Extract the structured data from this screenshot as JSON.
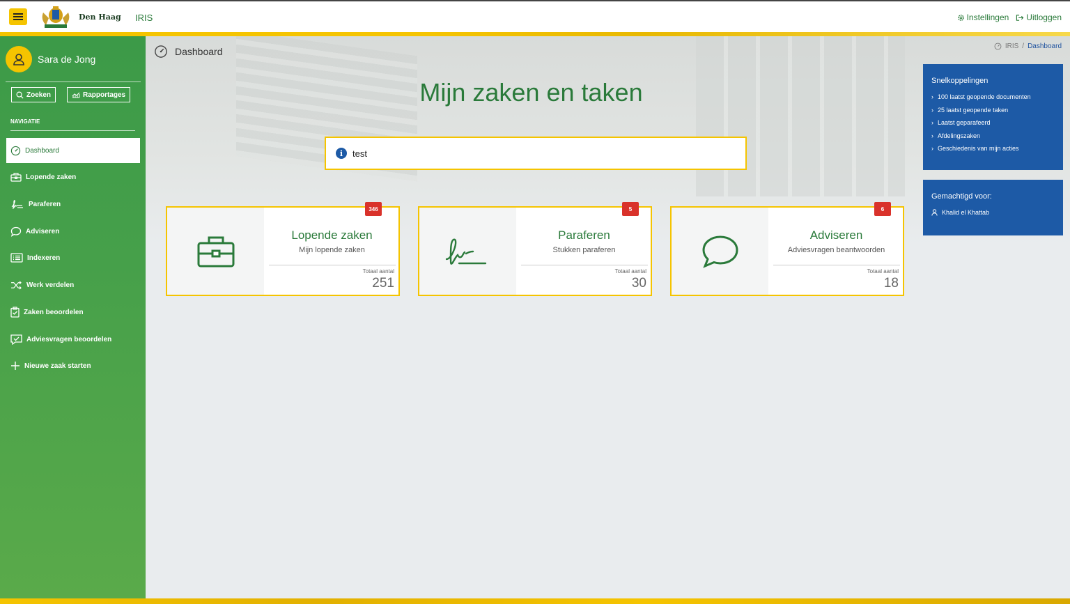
{
  "header": {
    "brand": "Den Haag",
    "app_name": "IRIS",
    "settings_label": "Instellingen",
    "logout_label": "Uitloggen"
  },
  "sidebar": {
    "user_name": "Sara de Jong",
    "search_label": "Zoeken",
    "reports_label": "Rapportages",
    "nav_heading": "NAVIGATIE",
    "items": [
      {
        "label": "Dashboard",
        "icon": "dashboard-icon",
        "active": true
      },
      {
        "label": "Lopende zaken",
        "icon": "briefcase-icon"
      },
      {
        "label": "Paraferen",
        "icon": "signature-icon"
      },
      {
        "label": "Adviseren",
        "icon": "chat-icon"
      },
      {
        "label": "Indexeren",
        "icon": "list-icon"
      },
      {
        "label": "Werk verdelen",
        "icon": "shuffle-icon"
      },
      {
        "label": "Zaken beoordelen",
        "icon": "clipboard-check-icon"
      },
      {
        "label": "Adviesvragen beoordelen",
        "icon": "message-check-icon"
      },
      {
        "label": "Nieuwe zaak starten",
        "icon": "plus-icon"
      }
    ]
  },
  "page": {
    "header_title": "Dashboard",
    "breadcrumb": {
      "root": "IRIS",
      "sep": "/",
      "current": "Dashboard"
    },
    "main_title": "Mijn zaken en taken",
    "info_message": "test"
  },
  "cards": [
    {
      "title": "Lopende zaken",
      "subtitle": "Mijn lopende zaken",
      "total_label": "Totaal aantal",
      "total": "251",
      "badge": "346"
    },
    {
      "title": "Paraferen",
      "subtitle": "Stukken paraferen",
      "total_label": "Totaal aantal",
      "total": "30",
      "badge": "5"
    },
    {
      "title": "Adviseren",
      "subtitle": "Adviesvragen beantwoorden",
      "total_label": "Totaal aantal",
      "total": "18",
      "badge": "6"
    }
  ],
  "shortcuts": {
    "title": "Snelkoppelingen",
    "items": [
      "100 laatst geopende documenten",
      "25 laatst geopende taken",
      "Laatst geparafeerd",
      "Afdelingszaken",
      "Geschiedenis van mijn acties"
    ]
  },
  "delegation": {
    "title": "Gemachtigd voor:",
    "person": "Khalid el Khattab"
  },
  "colors": {
    "green": "#2a7a3a",
    "yellow": "#f5c400",
    "blue": "#1d5aa6",
    "badge_red": "#d9322b"
  }
}
